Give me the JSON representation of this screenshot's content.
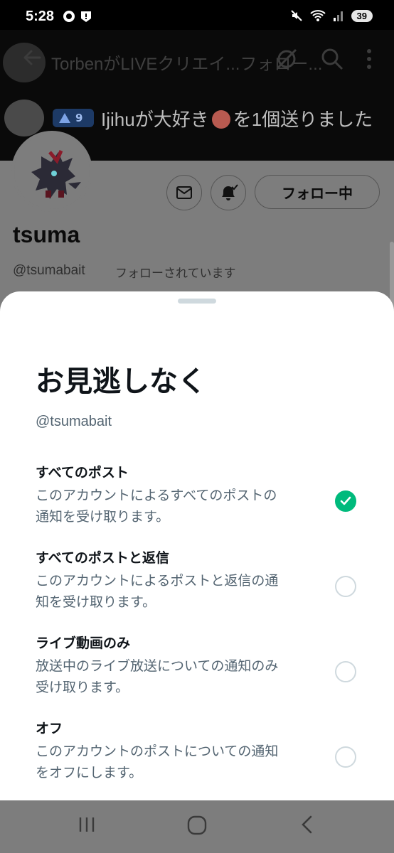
{
  "status_bar": {
    "time": "5:28",
    "battery": "39"
  },
  "background": {
    "live_banner_text": "TorbenがLIVEクリエイ...フォロー...",
    "gift_badge_count": "9",
    "gift_text_before": "Ijihuが大好き",
    "gift_text_after": "を1個送りました",
    "follow_button_label": "フォロー中",
    "profile_name": "tsuma",
    "profile_handle": "@tsumabait",
    "follows_you_label": "フォローされています"
  },
  "sheet": {
    "title": "お見逃しなく",
    "handle": "@tsumabait",
    "options": [
      {
        "title": "すべてのポスト",
        "desc_line1": "このアカウントによるすべてのポストの",
        "desc_line2": "通知を受け取ります。",
        "selected": true
      },
      {
        "title": "すべてのポストと返信",
        "desc_line1": "このアカウントによるポストと返信の通",
        "desc_line2": "知を受け取ります。",
        "selected": false
      },
      {
        "title": "ライブ動画のみ",
        "desc_line1": "放送中のライブ放送についての通知のみ",
        "desc_line2": "受け取ります。",
        "selected": false
      },
      {
        "title": "オフ",
        "desc_line1": "このアカウントのポストについての通知",
        "desc_line2": "をオフにします。",
        "selected": false
      }
    ]
  },
  "colors": {
    "accent_green": "#00ba7c",
    "scrim": "#7d7d7d",
    "text_primary": "#0f1419",
    "text_secondary": "#536471"
  },
  "icons": [
    "back-arrow-icon",
    "live-off-icon",
    "search-icon",
    "more-vert-icon",
    "mail-icon",
    "bell-check-icon",
    "check-icon",
    "nav-recent-icon",
    "nav-home-icon",
    "nav-back-icon"
  ]
}
